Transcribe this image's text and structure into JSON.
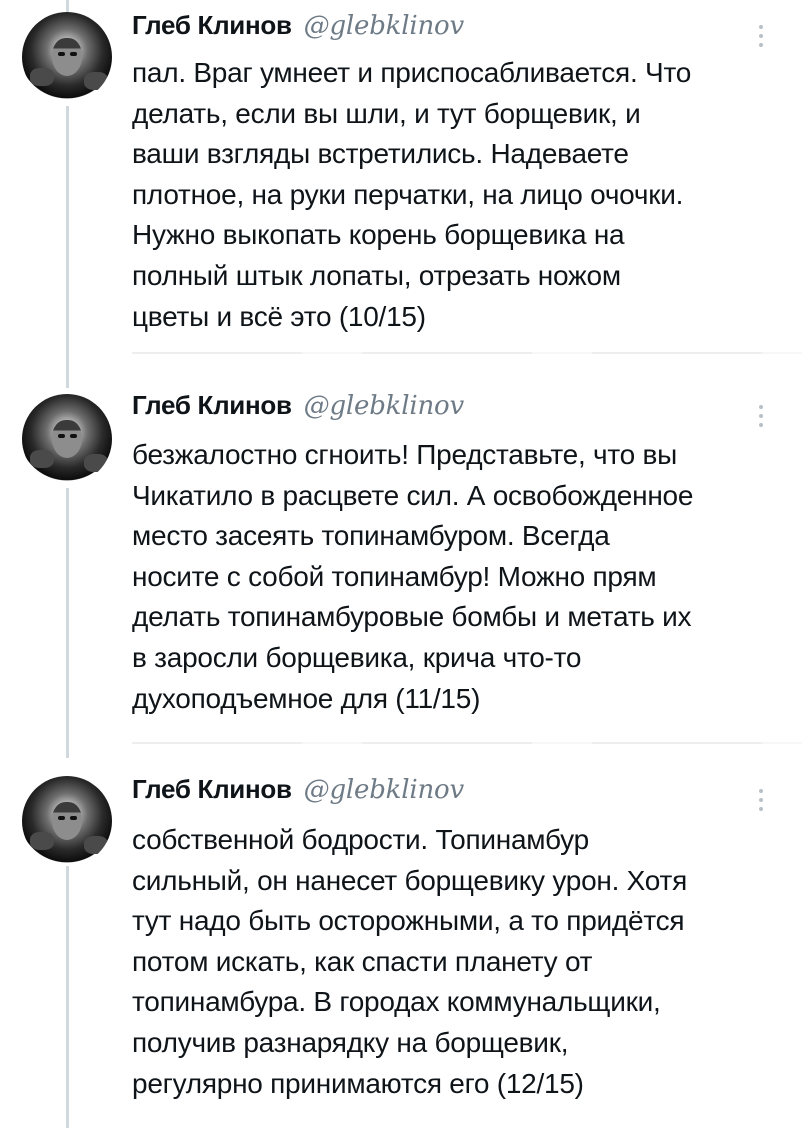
{
  "tweets": [
    {
      "author_name": "Глеб Клинов",
      "author_handle": "@glebklinov",
      "text": "пал. Враг умнеет и приспосабливается. Что\nделать, если вы шли, и тут борщевик, и\nваши взгляды встретились. Надеваете\nплотное, на руки перчатки, на лицо очочки.\nНужно выкопать корень борщевика на\nполный штык лопаты, отрезать ножом\nцветы и всё это (10/15)"
    },
    {
      "author_name": "Глеб Клинов",
      "author_handle": "@glebklinov",
      "text": "безжалостно сгноить! Представьте, что вы\nЧикатило в расцвете сил. А освобожденное\nместо засеять топинамбуром. Всегда\nносите с собой топинамбур! Можно прям\nделать топинамбуровые бомбы и метать их\nв заросли борщевика, крича что-то\nдухоподъемное для (11/15)"
    },
    {
      "author_name": "Глеб Клинов",
      "author_handle": "@glebklinov",
      "text": "собственной бодрости. Топинамбур\nсильный, он нанесет борщевику урон. Хотя\nтут надо быть осторожными, а то придётся\nпотом искать, как спасти планету от\nтопинамбура. В городах коммунальщики,\nполучив разнарядку на борщевик,\nрегулярно принимаются его (12/15)"
    }
  ],
  "icons": {
    "more": "more-vertical-icon",
    "avatar": "avatar"
  },
  "colors": {
    "text": "#0f1419",
    "handle": "#6e7b86",
    "thread_line": "#cfd9de",
    "background": "#ffffff"
  }
}
